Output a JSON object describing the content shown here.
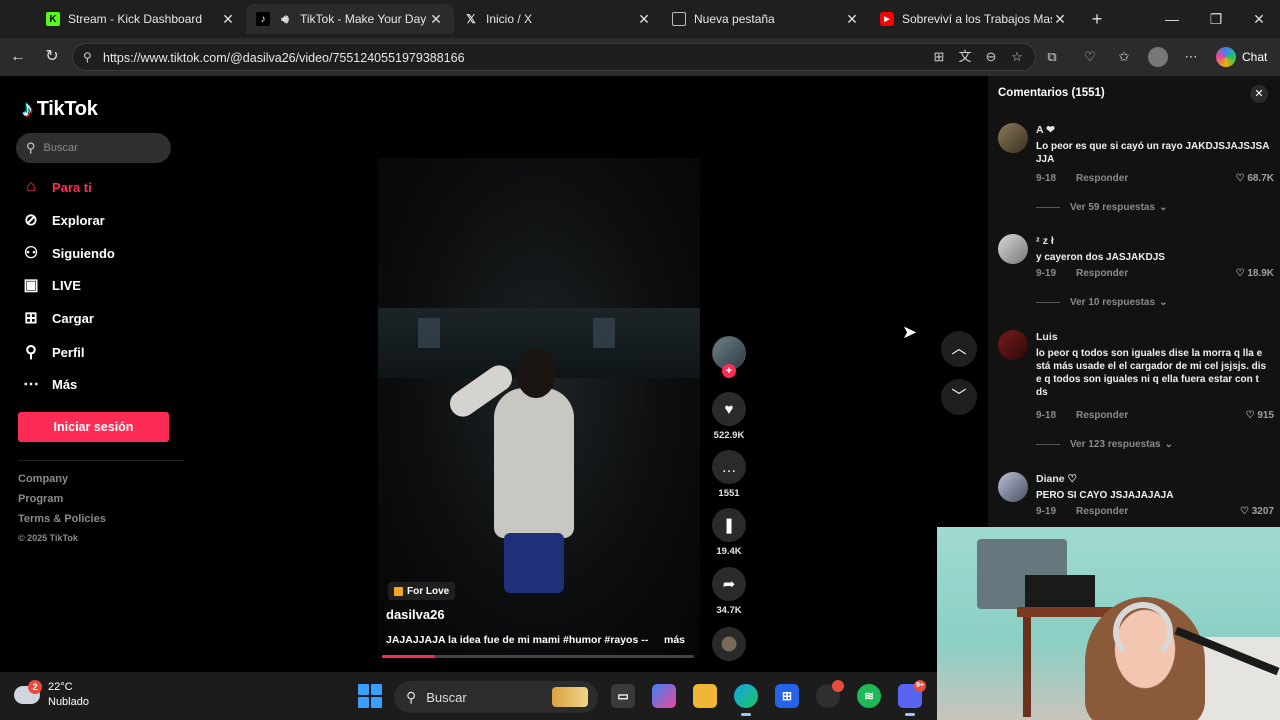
{
  "browser": {
    "tabs": [
      {
        "label": "Stream - Kick Dashboard",
        "icon": "kick-icon",
        "active": false
      },
      {
        "label": "TikTok - Make Your Day",
        "icon": "tiktok-icon",
        "active": true
      },
      {
        "label": "Inicio / X",
        "icon": "x-icon",
        "active": false
      },
      {
        "label": "Nueva pestaña",
        "icon": "new-tab-icon",
        "active": false
      },
      {
        "label": "Sobreviví a los Trabajos Mas Pe",
        "icon": "youtube-icon",
        "active": false
      }
    ],
    "url": "https://www.tiktok.com/@dasilva26/video/7551240551979388166",
    "chat_label": "Chat"
  },
  "tiktok": {
    "logo": "TikTok",
    "search_placeholder": "Buscar",
    "nav": [
      {
        "label": "Para ti",
        "icon": "home-icon",
        "active": true
      },
      {
        "label": "Explorar",
        "icon": "compass-icon",
        "active": false
      },
      {
        "label": "Siguiendo",
        "icon": "following-icon",
        "active": false
      },
      {
        "label": "LIVE",
        "icon": "live-icon",
        "active": false
      },
      {
        "label": "Cargar",
        "icon": "upload-icon",
        "active": false
      },
      {
        "label": "Perfil",
        "icon": "profile-icon",
        "active": false
      },
      {
        "label": "Más",
        "icon": "more-icon",
        "active": false
      }
    ],
    "login_label": "Iniciar sesión",
    "footer": [
      "Company",
      "Program",
      "Terms & Policies",
      "© 2025 TikTok"
    ],
    "video": {
      "tag": "For Love",
      "author": "dasilva26",
      "caption": "JAJAJJAJA la idea fue de mi mami #humor #rayos --",
      "more_label": "más",
      "progress": 0.17,
      "likes": "522.9K",
      "comments": "1551",
      "saves": "19.4K",
      "shares": "34.7K"
    },
    "comments_panel": {
      "title": "Comentarios (1551)",
      "items": [
        {
          "user": "A ❤",
          "text": "Lo peor es que si cayó un rayo JAKDJSJAJSJSA JJA",
          "date": "9-18",
          "reply": "Responder",
          "likes": "68.7K",
          "replies": "Ver 59 respuestas"
        },
        {
          "user": "ᶻ z ł",
          "text": "y cayeron dos JASJAKDJS",
          "date": "9-19",
          "reply": "Responder",
          "likes": "18.9K",
          "replies": "Ver 10 respuestas"
        },
        {
          "user": "Luis",
          "text": "lo peor q todos son iguales dise la morra q lla e stá más usade el el cargador de mi cel jsjsjs. dis e q todos son iguales ni q ella fuera estar con t ds",
          "date": "9-18",
          "reply": "Responder",
          "likes": "915",
          "replies": "Ver 123 respuestas"
        },
        {
          "user": "Diane ♡",
          "text": "PERO SI CAYO JSJAJAJAJA",
          "date": "9-19",
          "reply": "Responder",
          "likes": "3207"
        }
      ]
    }
  },
  "taskbar": {
    "weather_temp": "22°C",
    "weather_desc": "Nublado",
    "weather_badge": "2",
    "search_label": "Buscar",
    "discord_badge": "9+"
  },
  "colors": {
    "tiktok_accent": "#fe2c55",
    "background": "#000000",
    "panel": "#121212"
  }
}
